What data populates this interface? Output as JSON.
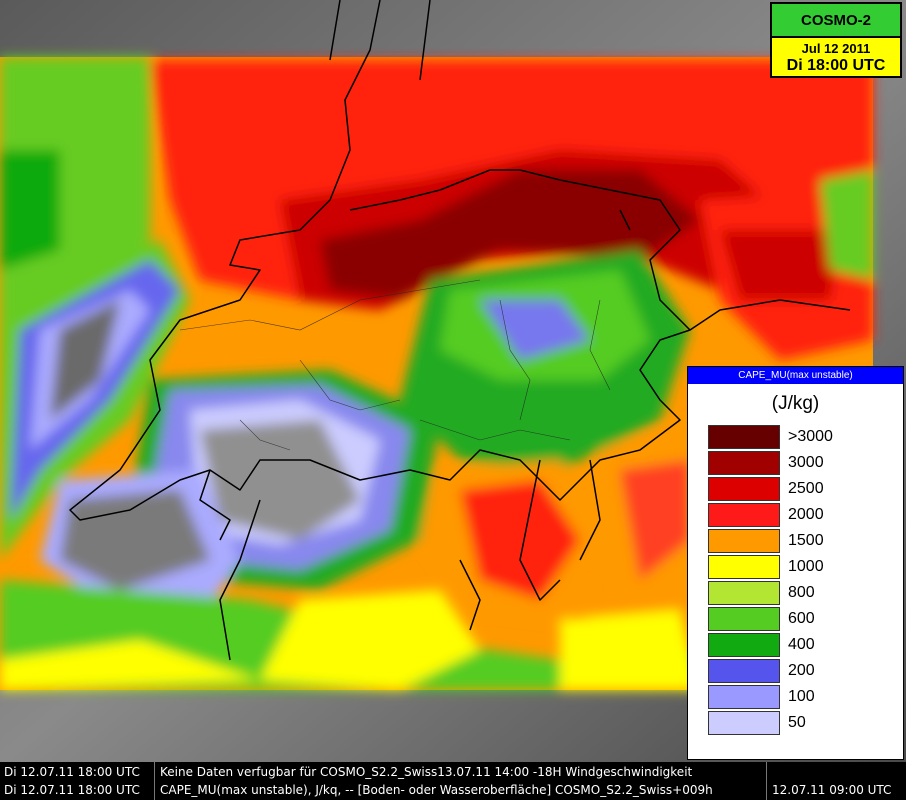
{
  "header": {
    "model": "COSMO-2",
    "date": "Jul 12 2011",
    "valid_time": "Di 18:00 UTC"
  },
  "legend": {
    "title": "CAPE_MU(max unstable)",
    "unit": "(J/kg)",
    "items": [
      {
        "label": ">3000",
        "color": "#660000"
      },
      {
        "label": "3000",
        "color": "#a00000"
      },
      {
        "label": "2500",
        "color": "#dd0000"
      },
      {
        "label": "2000",
        "color": "#ff1a1a"
      },
      {
        "label": "1500",
        "color": "#ff9900"
      },
      {
        "label": "1000",
        "color": "#ffff00"
      },
      {
        "label": "800",
        "color": "#b3e633"
      },
      {
        "label": "600",
        "color": "#55cc22"
      },
      {
        "label": "400",
        "color": "#11aa11"
      },
      {
        "label": "200",
        "color": "#5555ee"
      },
      {
        "label": "100",
        "color": "#9999ff"
      },
      {
        "label": "50",
        "color": "#ccccff"
      }
    ]
  },
  "status": {
    "row1": {
      "time": "Di 12.07.11 18:00 UTC",
      "text": "Keine Daten verfugbar für COSMO_S2.2_Swiss13.07.11 14:00 -18H Windgeschwindigkeit"
    },
    "row2": {
      "time": "Di 12.07.11 18:00 UTC",
      "text": "CAPE_MU(max unstable), J/kq, -- [Boden- oder Wasseroberfläche] COSMO_S2.2_Swiss+009h",
      "run": "12.07.11 09:00 UTC"
    }
  }
}
